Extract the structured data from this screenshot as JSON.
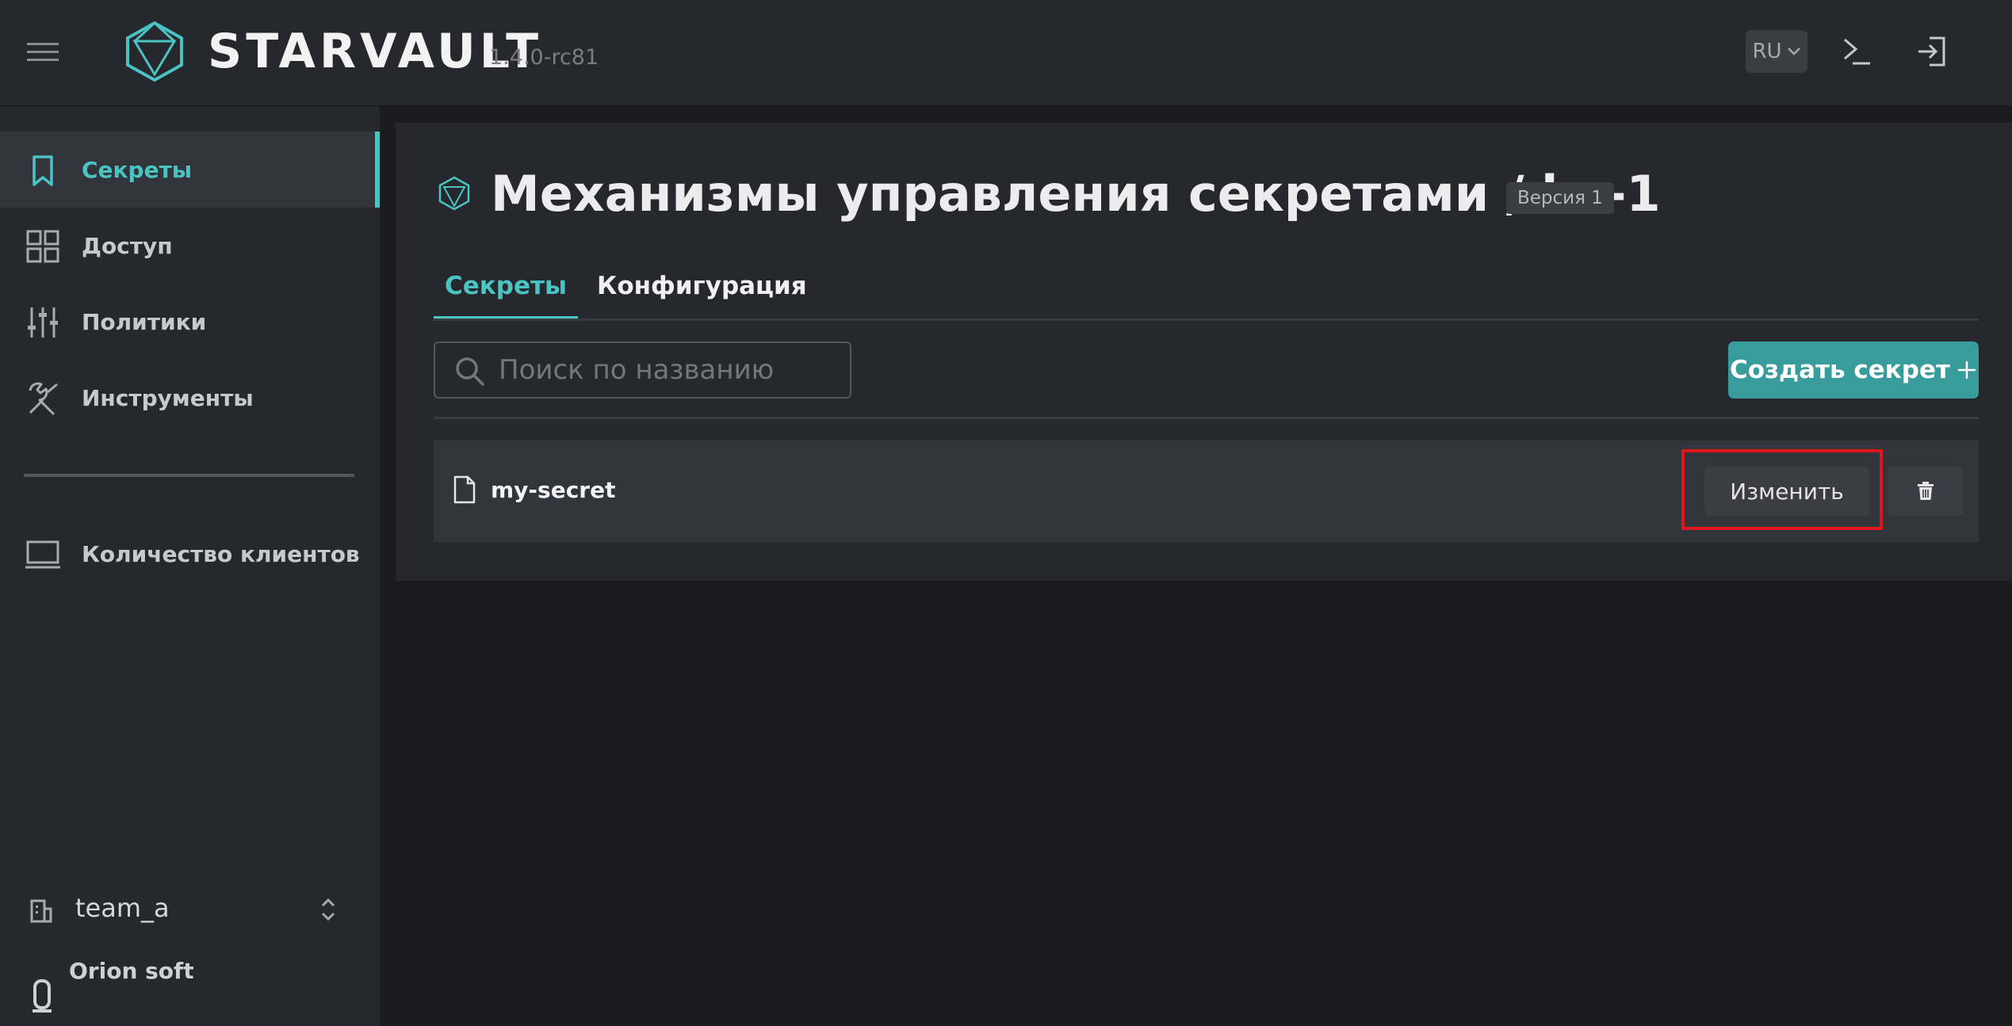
{
  "header": {
    "brand": "STARVAULT",
    "version": "1.4.0-rc81",
    "language": "RU"
  },
  "sidebar": {
    "items": [
      {
        "label": "Секреты",
        "icon": "bookmark-icon",
        "active": true
      },
      {
        "label": "Доступ",
        "icon": "grid-icon"
      },
      {
        "label": "Политики",
        "icon": "sliders-icon"
      },
      {
        "label": "Инструменты",
        "icon": "tools-icon"
      },
      {
        "label": "Количество клиентов",
        "icon": "monitor-icon"
      }
    ],
    "team": "team_a",
    "org": "Orion soft"
  },
  "main": {
    "title": "Механизмы управления секретами / kv-1",
    "version_badge": "Версия 1",
    "tabs": [
      {
        "label": "Секреты",
        "active": true
      },
      {
        "label": "Конфигурация"
      }
    ],
    "search_placeholder": "Поиск по названию",
    "create_button": "Создать секрет",
    "secrets": [
      {
        "name": "my-secret",
        "edit_label": "Изменить"
      }
    ]
  },
  "colors": {
    "accent": "#49c4c3",
    "button": "#399c9c",
    "highlight": "#e0161c",
    "background": "#1b1b20",
    "panel": "#27282e"
  }
}
